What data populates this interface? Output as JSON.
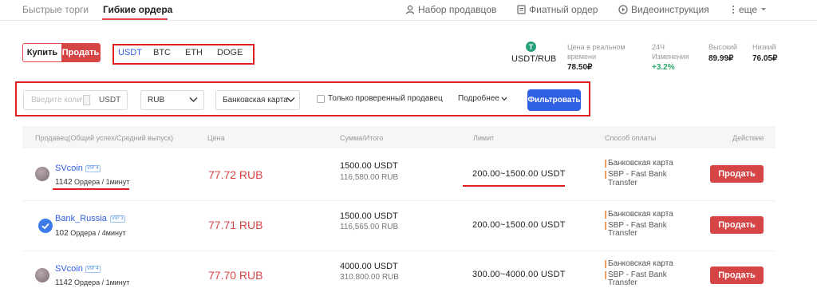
{
  "nav": {
    "tabs": [
      "Быстрые торги",
      "Гибкие ордера"
    ],
    "links": [
      "Набор продавцов",
      "Фиатный ордер",
      "Видеоинструкция",
      "еще"
    ]
  },
  "toggle": {
    "buy": "Купить",
    "sell": "Продать"
  },
  "coins": [
    "USDT",
    "BTC",
    "ETH",
    "DOGE"
  ],
  "ticker": {
    "icon": "T",
    "pair": "USDT/RUB",
    "realtime_label_1": "Цена в реальном",
    "realtime_label_2": "времени",
    "realtime_value": "78.50₽",
    "change_label_1": "24Ч",
    "change_label_2": "Изменения",
    "change_value": "+3.2%",
    "high_label": "Высокий",
    "high_value": "89.99₽",
    "low_label": "Низкий",
    "low_value": "76.05₽"
  },
  "filters": {
    "amount_placeholder": "Введите колич",
    "amount_unit": "USDT",
    "currency": "RUB",
    "payment": "Банковская карта",
    "verified_label": "Только проверенный продавец",
    "more": "Подробнее",
    "filter_button": "Фильтровать"
  },
  "table": {
    "headers": [
      "Продавец(Общий успех/Средний выпуск)",
      "Цена",
      "Сумма/Итого",
      "Лимит",
      "Способ оплаты",
      "Действие"
    ],
    "rows": [
      {
        "seller": "SVcoin",
        "vip": "VIP 4",
        "orders_count": "1142",
        "orders_text": " Ордера / 1минут",
        "price": "77.72 RUB",
        "amount": "1500.00 USDT",
        "total": "116,580.00 RUB",
        "limit": "200.00~1500.00 USDT",
        "pay1": "Банковская карта",
        "pay2": "SBP - Fast Bank",
        "pay3": "Transfer",
        "action": "Продать"
      },
      {
        "seller": "Bank_Russia",
        "vip": "VIP 3",
        "orders_count": "102",
        "orders_text": " Ордера / 4минут",
        "price": "77.71 RUB",
        "amount": "1500.00 USDT",
        "total": "116,565.00 RUB",
        "limit": "200.00~1500.00 USDT",
        "pay1": "Банковская карта",
        "pay2": "SBP - Fast Bank",
        "pay3": "Transfer",
        "action": "Продать"
      },
      {
        "seller": "SVcoin",
        "vip": "VIP 4",
        "orders_count": "1142",
        "orders_text": " Ордера / 1минут",
        "price": "77.70 RUB",
        "amount": "4000.00 USDT",
        "total": "310,800.00 RUB",
        "limit": "300.00~4000.00 USDT",
        "pay1": "Банковская карта",
        "pay2": "SBP - Fast Bank",
        "pay3": "Transfer",
        "action": "Продать"
      }
    ]
  },
  "colors": {
    "accent_red": "#d64545",
    "accent_blue": "#2f5fe3",
    "annotation_red": "#e02020",
    "positive_green": "#2aa86a"
  }
}
